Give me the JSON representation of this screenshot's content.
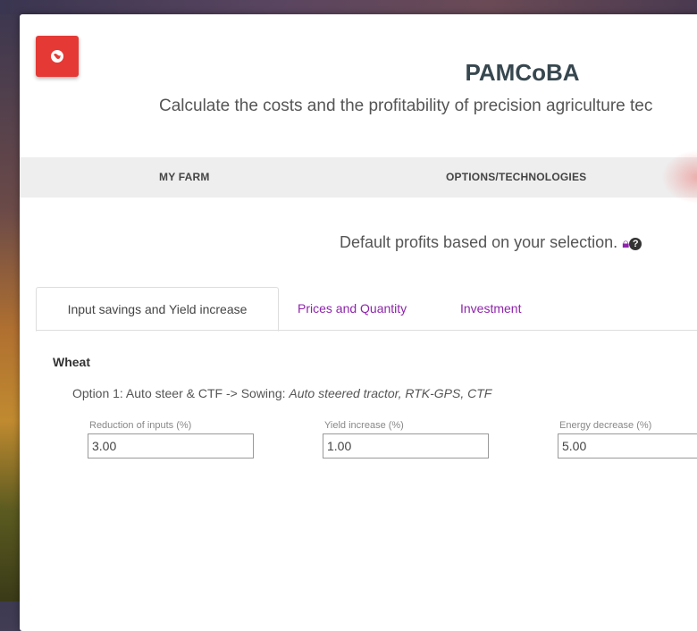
{
  "app": {
    "title": "PAMCoBA",
    "subtitle": "Calculate the costs and the profitability of precision agriculture tec",
    "brand_color": "#e53935",
    "accent_color": "#8e24aa"
  },
  "nav": {
    "items": [
      {
        "label": "MY FARM"
      },
      {
        "label": "OPTIONS/TECHNOLOGIES"
      }
    ]
  },
  "notice": {
    "text": "Default profits based on your selection.",
    "icons": [
      "lock-icon",
      "help-icon"
    ]
  },
  "tabs": [
    {
      "label": "Input savings and Yield increase",
      "active": true
    },
    {
      "label": "Prices and Quantity",
      "active": false
    },
    {
      "label": "Investment",
      "active": false
    }
  ],
  "crop": {
    "name": "Wheat",
    "option_prefix": "Option 1: Auto steer & CTF -> Sowing: ",
    "option_detail": "Auto steered tractor, RTK-GPS, CTF",
    "fields": [
      {
        "label": "Reduction of inputs (%)",
        "value": "3.00"
      },
      {
        "label": "Yield increase (%)",
        "value": "1.00"
      },
      {
        "label": "Energy decrease (%)",
        "value": "5.00"
      }
    ]
  }
}
